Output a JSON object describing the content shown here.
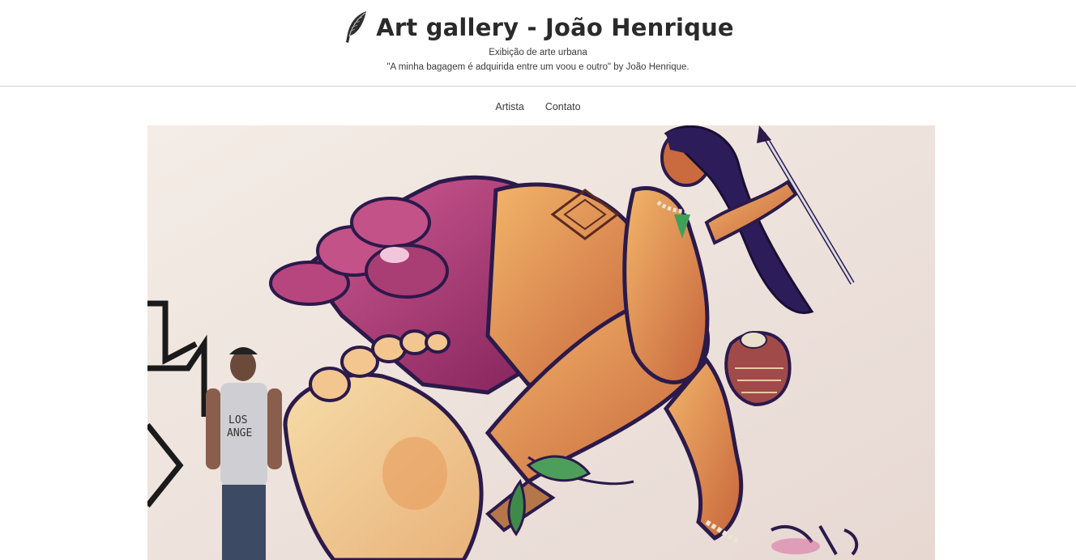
{
  "header": {
    "logo_icon": "feather-quill-icon",
    "title": "Art gallery - João Henrique",
    "subtitle": "Exibição de arte urbana",
    "quote": "\"A minha bagagem é adquirida entre um voou e outro\" by João Henrique."
  },
  "nav": {
    "items": [
      {
        "label": "Artista"
      },
      {
        "label": "Contato"
      }
    ]
  },
  "artwork": {
    "description_icon": "graffiti-mural-image",
    "colors": {
      "wall": "#efe5de",
      "skin": "#e39b4f",
      "magenta": "#b0306f",
      "outline": "#2b1a4a"
    }
  }
}
